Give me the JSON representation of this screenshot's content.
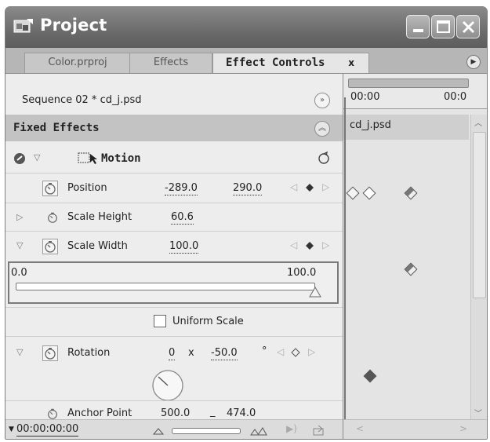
{
  "window": {
    "title": "Project"
  },
  "tabs": [
    {
      "label": "Color.prproj"
    },
    {
      "label": "Effects"
    },
    {
      "label": "Effect Controls",
      "close": "x"
    }
  ],
  "header": {
    "sequence": "Sequence 02 * cd_j.psd",
    "fixed_effects": "Fixed Effects"
  },
  "motion": {
    "label": "Motion"
  },
  "properties": {
    "position": {
      "label": "Position",
      "x": "-289.0",
      "y": "290.0"
    },
    "scale_height": {
      "label": "Scale Height",
      "value": "60.6"
    },
    "scale_width": {
      "label": "Scale Width",
      "value": "100.0",
      "slider_min": "0.0",
      "slider_max": "100.0",
      "slider_level": 1.0
    },
    "uniform_scale": {
      "label": "Uniform Scale",
      "checked": false
    },
    "rotation": {
      "label": "Rotation",
      "turns": "0",
      "times": "x",
      "degrees": "-50.0",
      "deg_symbol": "°"
    },
    "anchor_point": {
      "label": "Anchor Point",
      "x": "500.0",
      "sep": "_",
      "y": "474.0"
    }
  },
  "timeline": {
    "time_start": "00:00",
    "time_end": "00:0",
    "clip_name": "cd_j.psd"
  },
  "footer": {
    "timecode": "00:00:00:00"
  },
  "colors": {
    "title_bg": "#6f6f6f",
    "panel_bg": "#ededed",
    "highlight_border": "#7a7a7a"
  },
  "icons": [
    "project-icon",
    "minimize-icon",
    "maximize-icon",
    "close-icon",
    "panel-menu-icon",
    "stopwatch-icon",
    "keyframe-diamond-icon",
    "reset-icon",
    "fx-toggle-icon"
  ]
}
